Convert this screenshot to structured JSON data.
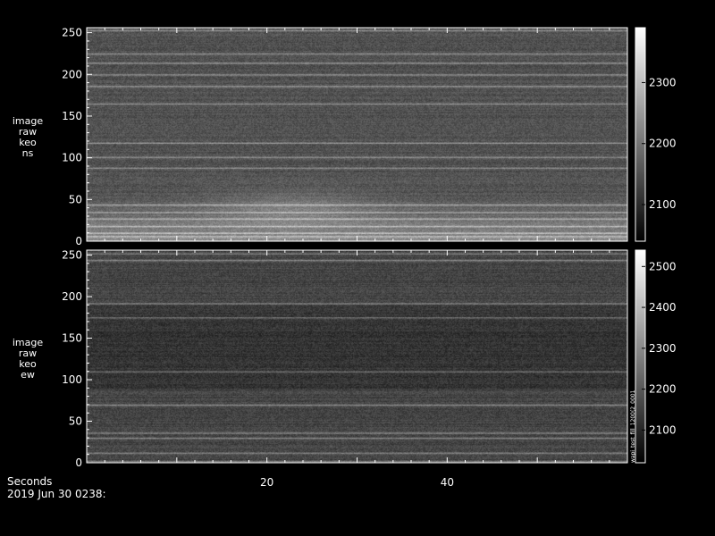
{
  "chart_data": [
    {
      "type": "heatmap",
      "panel": "ns",
      "ylabel_lines": [
        "image",
        "raw",
        "keo",
        "ns"
      ],
      "x_range": [
        0,
        60
      ],
      "y_range": [
        0,
        256
      ],
      "y_ticks": [
        0,
        50,
        100,
        150,
        200,
        250
      ],
      "colorbar_range": [
        2040,
        2390
      ],
      "colorbar_ticks": [
        2100,
        2200,
        2300
      ],
      "bright_rows": [
        0,
        6,
        10,
        18,
        27,
        35,
        44,
        88,
        101,
        118,
        165,
        186,
        200,
        214,
        225,
        253
      ],
      "base_intensity": 0.32
    },
    {
      "type": "heatmap",
      "panel": "ew",
      "ylabel_lines": [
        "image",
        "raw",
        "keo",
        "ew"
      ],
      "x_range": [
        0,
        60
      ],
      "y_range": [
        0,
        256
      ],
      "y_ticks": [
        0,
        50,
        100,
        150,
        200,
        250
      ],
      "colorbar_range": [
        2020,
        2540
      ],
      "colorbar_ticks": [
        2100,
        2200,
        2300,
        2400,
        2500
      ],
      "bright_rows": [
        2,
        12,
        30,
        36,
        70,
        110,
        175,
        192,
        244,
        252
      ],
      "base_intensity": 0.27
    }
  ],
  "x_axis": {
    "label": "Seconds",
    "ticks": [
      20,
      40
    ],
    "date_label": "2019 Jun 30 0238:"
  },
  "stamp_text": "wapi_test_fill_1200(2_0001"
}
